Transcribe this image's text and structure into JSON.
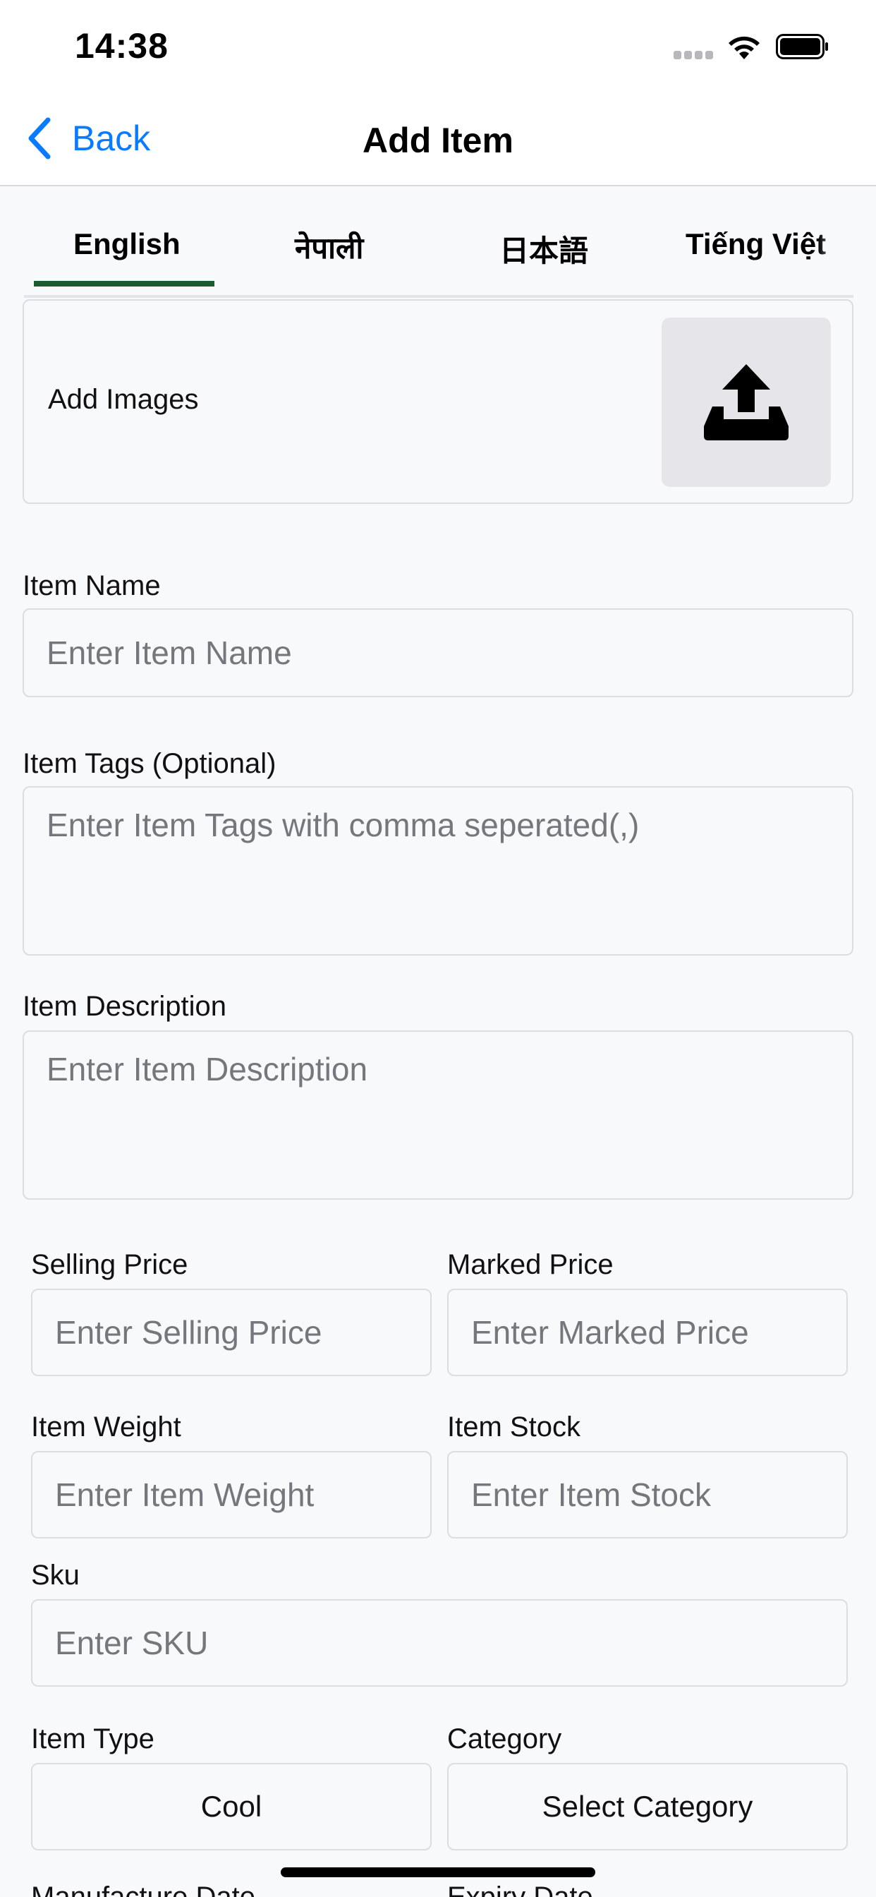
{
  "status_bar": {
    "time": "14:38",
    "icons": [
      "signal-dots-icon",
      "wifi-icon",
      "battery-icon"
    ]
  },
  "nav": {
    "back_label": "Back",
    "title": "Add Item",
    "accent_color": "#0a7bff"
  },
  "tabs": {
    "items": [
      {
        "label": "English",
        "active": true
      },
      {
        "label": "नेपाली",
        "active": false
      },
      {
        "label": "日本語",
        "active": false
      },
      {
        "label": "Tiếng Việt",
        "active": false
      }
    ],
    "active_color": "#1d5c31"
  },
  "images": {
    "label": "Add Images",
    "upload_icon": "upload-icon"
  },
  "form": {
    "item_name": {
      "label": "Item Name",
      "placeholder": "Enter Item Name",
      "value": ""
    },
    "item_tags": {
      "label": "Item Tags (Optional)",
      "placeholder": "Enter Item Tags with comma seperated(,)",
      "value": ""
    },
    "item_description": {
      "label": "Item Description",
      "placeholder": "Enter Item Description",
      "value": ""
    },
    "selling_price": {
      "label": "Selling Price",
      "placeholder": "Enter Selling Price",
      "value": ""
    },
    "marked_price": {
      "label": "Marked Price",
      "placeholder": "Enter Marked Price",
      "value": ""
    },
    "item_weight": {
      "label": "Item Weight",
      "placeholder": "Enter Item Weight",
      "value": ""
    },
    "item_stock": {
      "label": "Item Stock",
      "placeholder": "Enter Item Stock",
      "value": ""
    },
    "sku": {
      "label": "Sku",
      "placeholder": "Enter SKU",
      "value": ""
    },
    "item_type": {
      "label": "Item Type",
      "value": "Cool"
    },
    "category": {
      "label": "Category",
      "value": "Select Category"
    },
    "manufacture_date": {
      "label": "Manufacture Date"
    },
    "expiry_date": {
      "label": "Expiry Date"
    }
  }
}
